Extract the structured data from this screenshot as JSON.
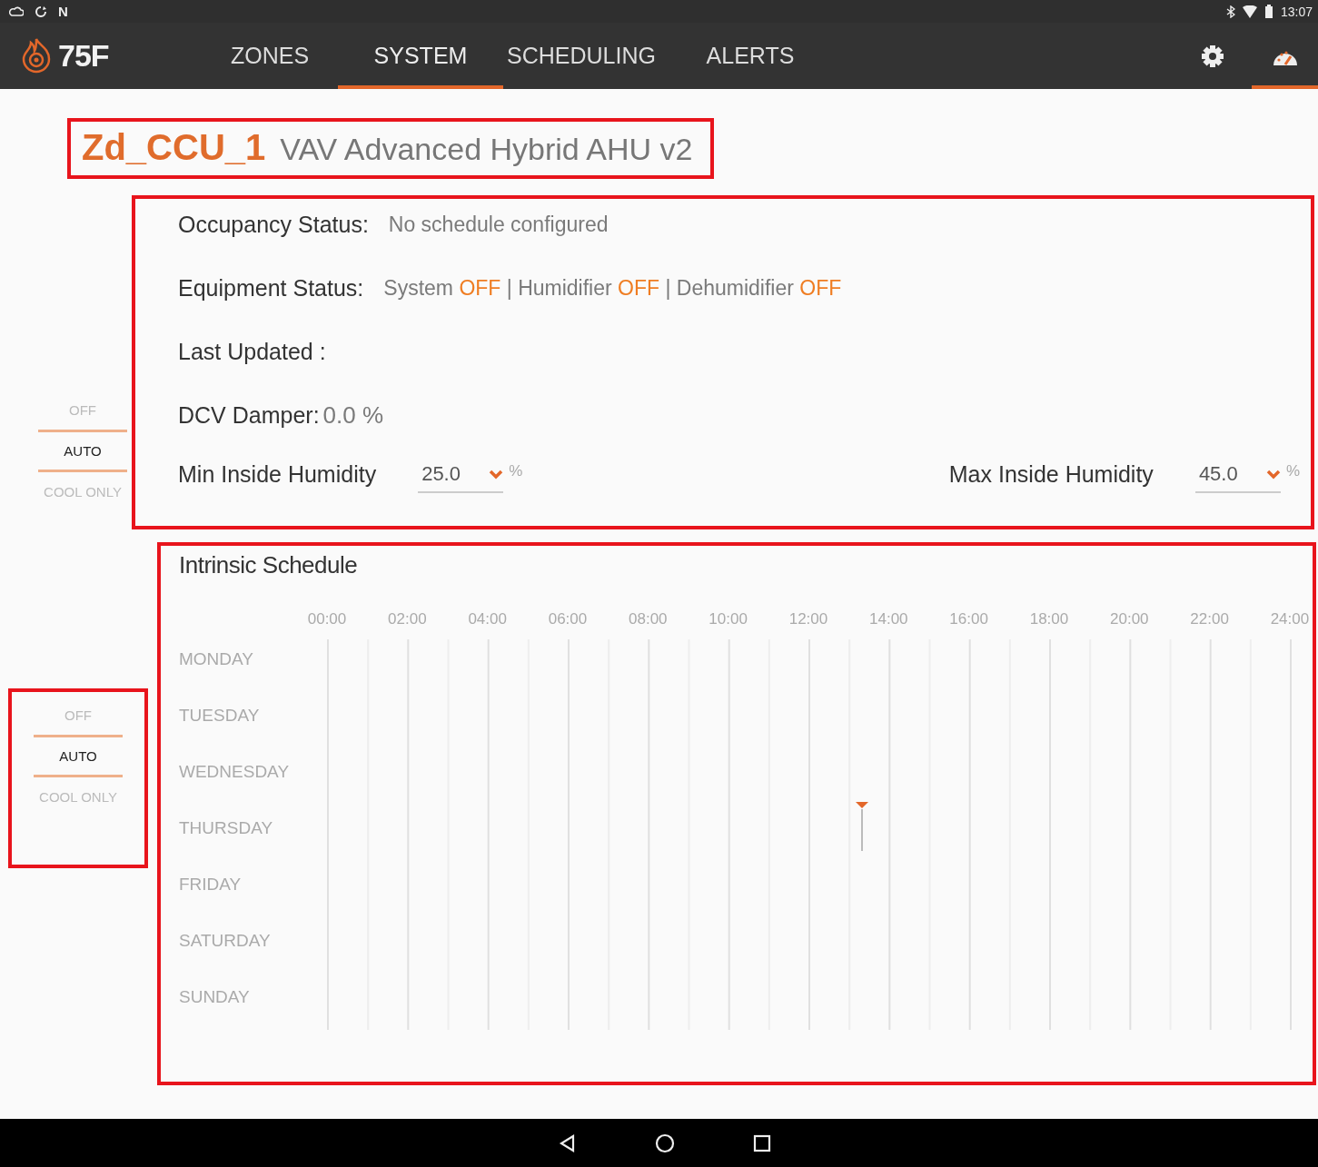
{
  "status_bar": {
    "letter": "N",
    "time": "13:07"
  },
  "app_bar": {
    "logo": "75F",
    "tabs": [
      {
        "label": "ZONES",
        "selected": false
      },
      {
        "label": "SYSTEM",
        "selected": true
      },
      {
        "label": "SCHEDULING",
        "selected": false
      },
      {
        "label": "ALERTS",
        "selected": false
      }
    ],
    "icon_tabs": [
      {
        "kind": "settings",
        "selected": false
      },
      {
        "kind": "dashboard",
        "selected": true
      }
    ]
  },
  "header": {
    "name": "Zd_CCU_1",
    "profile": "VAV Advanced Hybrid AHU v2"
  },
  "mode_pickers": [
    {
      "items": [
        {
          "label": "OFF",
          "selected": false
        },
        {
          "label": "AUTO",
          "selected": true
        },
        {
          "label": "COOL ONLY",
          "selected": false
        }
      ]
    },
    {
      "items": [
        {
          "label": "OFF",
          "selected": false
        },
        {
          "label": "AUTO",
          "selected": true
        },
        {
          "label": "COOL ONLY",
          "selected": false
        }
      ]
    }
  ],
  "status": {
    "occupancy": {
      "label": "Occupancy Status:",
      "value": "No schedule configured"
    },
    "equipment": {
      "label": "Equipment Status:",
      "separator": "|",
      "parts": [
        {
          "name": "System",
          "value": "OFF"
        },
        {
          "name": "Humidifier",
          "value": "OFF"
        },
        {
          "name": "Dehumidifier",
          "value": "OFF"
        }
      ]
    },
    "last_updated": {
      "label": "Last Updated :"
    },
    "dcv_damper": {
      "label": "DCV Damper:",
      "value": "0.0 %"
    },
    "humidity": [
      {
        "label": "Min Inside Humidity",
        "value": "25.0",
        "unit": "%"
      },
      {
        "label": "Max Inside Humidity",
        "value": "45.0",
        "unit": "%"
      }
    ]
  },
  "schedule": {
    "title": "Intrinsic Schedule",
    "times": [
      "00:00",
      "02:00",
      "04:00",
      "06:00",
      "08:00",
      "10:00",
      "12:00",
      "14:00",
      "16:00",
      "18:00",
      "20:00",
      "22:00",
      "24:00"
    ],
    "days": [
      "MONDAY",
      "TUESDAY",
      "WEDNESDAY",
      "THURSDAY",
      "FRIDAY",
      "SATURDAY",
      "SUNDAY"
    ]
  }
}
